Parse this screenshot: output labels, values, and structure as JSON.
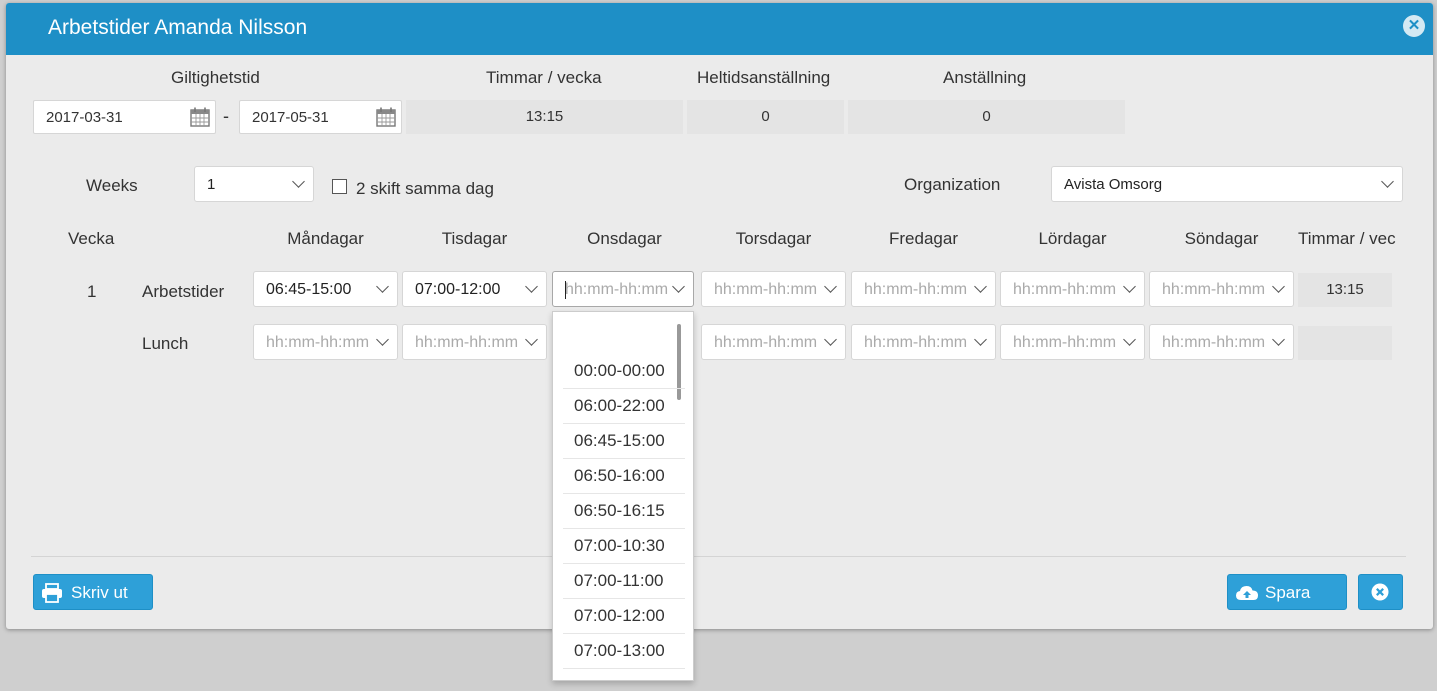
{
  "dialog": {
    "title": "Arbetstider Amanda Nilsson"
  },
  "header": {
    "validity_label": "Giltighetstid",
    "hours_week_label": "Timmar / vecka",
    "fulltime_label": "Heltidsanställning",
    "employment_label": "Anställning",
    "date_from": "2017-03-31",
    "date_separator": "-",
    "date_to": "2017-05-31",
    "hours_week_value": "13:15",
    "fulltime_value": "0",
    "employment_value": "0"
  },
  "options": {
    "weeks_label": "Weeks",
    "weeks_value": "1",
    "two_shifts_label": "2 skift samma dag",
    "two_shifts_checked": false,
    "organization_label": "Organization",
    "organization_value": "Avista Omsorg"
  },
  "schedule": {
    "columns": [
      "Vecka",
      "Måndagar",
      "Tisdagar",
      "Onsdagar",
      "Torsdagar",
      "Fredagar",
      "Lördagar",
      "Söndagar",
      "Timmar / vec"
    ],
    "week_number": "1",
    "row_labels": {
      "work": "Arbetstider",
      "lunch": "Lunch"
    },
    "placeholder": "hh:mm-hh:mm",
    "work_values": [
      "06:45-15:00",
      "07:00-12:00",
      "",
      "",
      "",
      "",
      ""
    ],
    "lunch_values": [
      "",
      "",
      "",
      "",
      "",
      "",
      ""
    ],
    "work_total": "13:15"
  },
  "dropdown": {
    "items": [
      "00:00-00:00",
      "06:00-22:00",
      "06:45-15:00",
      "06:50-16:00",
      "06:50-16:15",
      "07:00-10:30",
      "07:00-11:00",
      "07:00-12:00",
      "07:00-13:00"
    ]
  },
  "footer": {
    "print_label": "Skriv ut",
    "save_label": "Spara"
  },
  "colors": {
    "accent": "#1e8fc6",
    "button": "#2ea0d8",
    "background": "#ebebeb"
  },
  "icons": [
    "close-icon",
    "calendar-icon",
    "chevron-down-icon",
    "printer-icon",
    "cloud-upload-icon"
  ]
}
